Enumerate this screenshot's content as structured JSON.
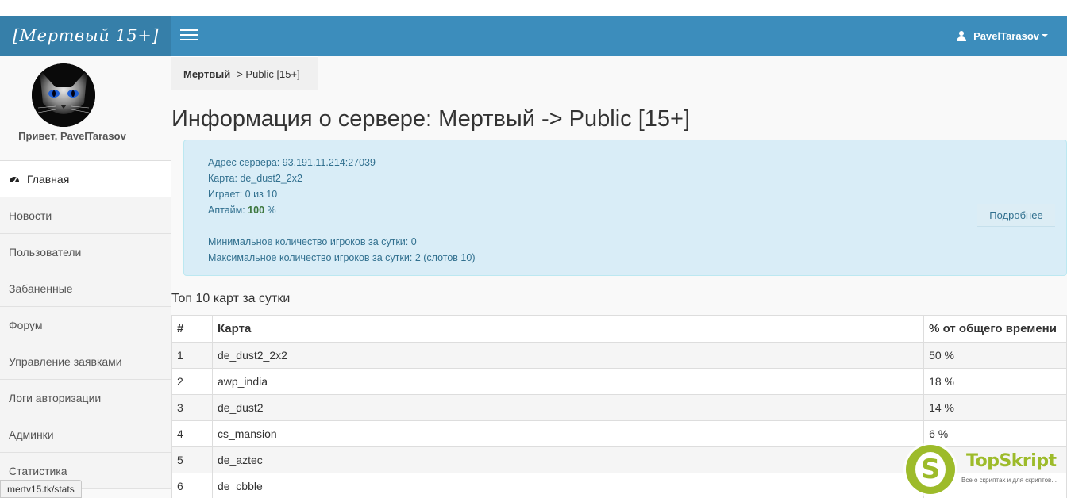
{
  "header": {
    "brand": "[Мертвый 15+]",
    "username": "PavelTarasov"
  },
  "sidebar": {
    "greeting": "Привет, PavelTarasov",
    "items": [
      {
        "label": "Главная",
        "icon": "dashboard-icon",
        "active": true
      },
      {
        "label": "Новости"
      },
      {
        "label": "Пользователи"
      },
      {
        "label": "Забаненные"
      },
      {
        "label": "Форум"
      },
      {
        "label": "Управление заявками"
      },
      {
        "label": "Логи авторизации"
      },
      {
        "label": "Админки"
      },
      {
        "label": "Статистика"
      }
    ]
  },
  "breadcrumb": {
    "bold": "Мертвый",
    "rest": " -> Public [15+]"
  },
  "page": {
    "title": "Информация о сервере: Мертвый -> Public [15+]"
  },
  "info": {
    "address_label": "Адрес сервера: ",
    "address_value": "93.191.11.214:27039",
    "map_label": "Карта: ",
    "map_value": "de_dust2_2x2",
    "playing_label": "Играет: ",
    "playing_value": "0 из 10",
    "uptime_label": "Аптайм: ",
    "uptime_value": "100",
    "uptime_unit": " %",
    "min_label": "Минимальное количество игроков за сутки: ",
    "min_value": "0",
    "max_label": "Максимальное количество игроков за сутки: ",
    "max_value": "2 (слотов 10)",
    "details_button": "Подробнее"
  },
  "top_maps": {
    "title": "Топ 10 карт за сутки",
    "columns": [
      "#",
      "Карта",
      "% от общего времени"
    ],
    "rows": [
      [
        "1",
        "de_dust2_2x2",
        "50 %"
      ],
      [
        "2",
        "awp_india",
        "18 %"
      ],
      [
        "3",
        "de_dust2",
        "14 %"
      ],
      [
        "4",
        "cs_mansion",
        "6 %"
      ],
      [
        "5",
        "de_aztec",
        ""
      ],
      [
        "6",
        "de_cbble",
        ""
      ]
    ]
  },
  "statusbar": {
    "url": "mertv15.tk/stats"
  },
  "watermark": {
    "letter": "S",
    "name": "TopSkript",
    "tagline": "Все о скриптах и для скриптов..."
  },
  "colors": {
    "navbar": "#3c8dbc",
    "brand_bg": "#367fa9",
    "info_bg": "#d9edf7",
    "info_text": "#31708f",
    "uptime": "#3c763d",
    "watermark": "#9dbb2a"
  }
}
